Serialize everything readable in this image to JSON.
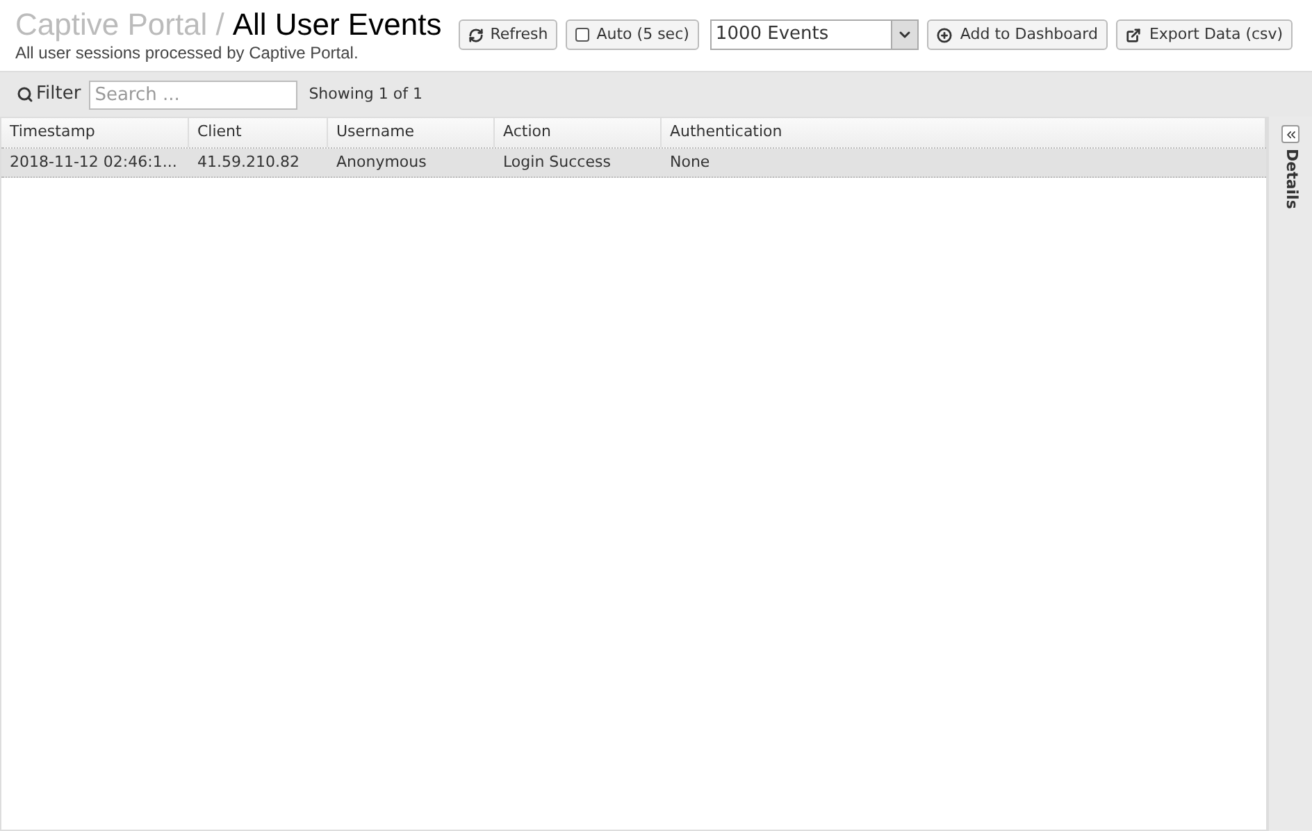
{
  "breadcrumb": {
    "parent": "Captive Portal",
    "separator": "/",
    "title": "All User Events"
  },
  "subtitle": "All user sessions processed by Captive Portal.",
  "toolbar": {
    "refresh": "Refresh",
    "auto": {
      "label": "Auto (5 sec)",
      "checked": false
    },
    "limit": "1000 Events",
    "add_dashboard": "Add to Dashboard",
    "export": "Export Data (csv)"
  },
  "filter": {
    "label": "Filter",
    "placeholder": "Search ...",
    "count": "Showing 1 of 1"
  },
  "table": {
    "columns": [
      "Timestamp",
      "Client",
      "Username",
      "Action",
      "Authentication"
    ],
    "rows": [
      {
        "cells": [
          "2018-11-12 02:46:1...",
          "41.59.210.82",
          "Anonymous",
          "Login Success",
          "None"
        ],
        "selected": true
      }
    ]
  },
  "details": {
    "label": "Details"
  }
}
